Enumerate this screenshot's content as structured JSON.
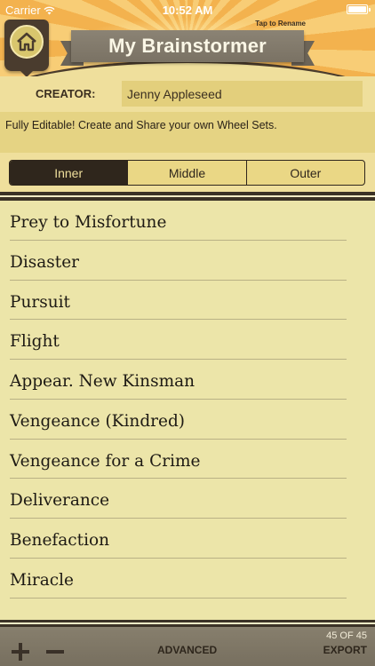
{
  "status_bar": {
    "carrier": "Carrier",
    "time": "10:52 AM"
  },
  "header": {
    "title": "My Brainstormer",
    "tap_hint": "Tap to Rename"
  },
  "creator": {
    "label": "CREATOR:",
    "value": "Jenny Appleseed"
  },
  "description": "Fully Editable! Create and Share your own Wheel Sets.",
  "tabs": [
    {
      "label": "Inner",
      "active": true
    },
    {
      "label": "Middle",
      "active": false
    },
    {
      "label": "Outer",
      "active": false
    }
  ],
  "items": [
    "Prey to Misfortune",
    "Disaster",
    "Pursuit",
    "Flight",
    "Appear. New Kinsman",
    "Vengeance (Kindred)",
    "Vengeance for a Crime",
    "Deliverance",
    "Benefaction",
    "Miracle"
  ],
  "toolbar": {
    "advanced_label": "ADVANCED",
    "count": "45 OF 45",
    "export_label": "EXPORT"
  },
  "colors": {
    "accent_dark": "#2f261c",
    "panel": "#efdf9c",
    "list_bg": "#ece5a9",
    "ribbon": "#7a7264"
  }
}
